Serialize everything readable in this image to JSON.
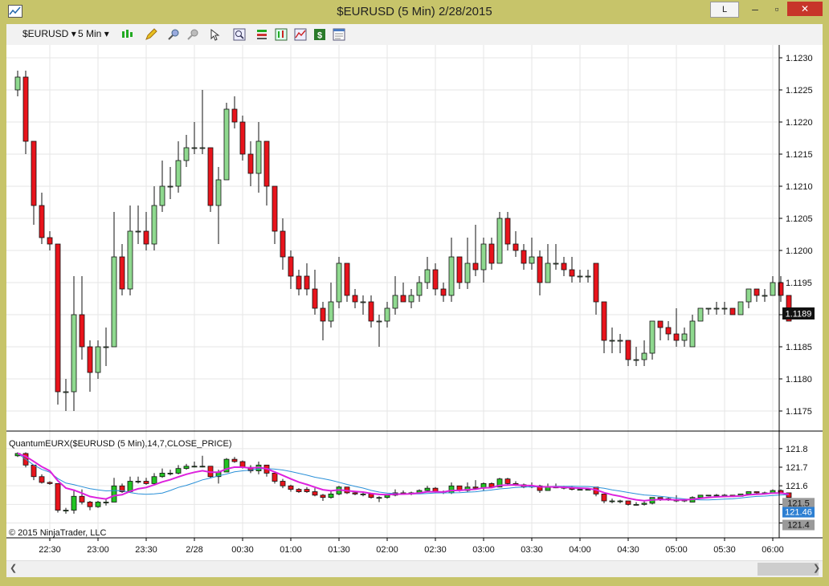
{
  "window": {
    "title": "$EURUSD (5 Min)  2/28/2015",
    "link_button": "L",
    "minimize_glyph": "‒",
    "maximize_glyph": "▫",
    "close_glyph": "✕"
  },
  "toolbar": {
    "instrument": "$EURUSD",
    "interval": "5 Min",
    "dropdown_glyph": "▾",
    "icons": [
      "bar-type-icon",
      "drawing-pencil-icon",
      "zoom-in-icon",
      "zoom-out-icon",
      "cursor-icon",
      "search-icon",
      "properties-icon",
      "strategies-icon",
      "indicators-icon",
      "dollar-icon",
      "data-box-icon"
    ]
  },
  "colors": {
    "up": "#8fd98f",
    "down": "#e8141c",
    "panel_up": "#22c422",
    "indicator_magenta": "#dd22dd",
    "indicator_blue": "#2a90d8",
    "last_price_bg": "#111111",
    "indicator_price_bg": "#2d7fd2"
  },
  "chart_data": [
    {
      "type": "candlestick",
      "panel": "price",
      "ylim": [
        1.1172,
        1.1232
      ],
      "y_ticks": [
        "1.1175",
        "1.1180",
        "1.1185",
        "1.1190",
        "1.1195",
        "1.1200",
        "1.1205",
        "1.1210",
        "1.1215",
        "1.1220",
        "1.1225",
        "1.1230"
      ],
      "x_ticks": [
        "22:30",
        "23:00",
        "23:30",
        "2/28",
        "00:30",
        "01:00",
        "01:30",
        "02:00",
        "02:30",
        "03:00",
        "03:30",
        "04:00",
        "04:30",
        "05:00",
        "05:30",
        "06:00"
      ],
      "last_price": "1.1189",
      "candles": [
        [
          1.1225,
          1.1227,
          1.1228,
          1.1224
        ],
        [
          1.1227,
          1.1217,
          1.1228,
          1.1215
        ],
        [
          1.1217,
          1.1207,
          1.1217,
          1.1204
        ],
        [
          1.1207,
          1.1202,
          1.1209,
          1.1201
        ],
        [
          1.1202,
          1.1201,
          1.1203,
          1.12
        ],
        [
          1.1201,
          1.1178,
          1.1201,
          1.1176
        ],
        [
          1.1178,
          1.1178,
          1.118,
          1.1175
        ],
        [
          1.1178,
          1.119,
          1.1196,
          1.1175
        ],
        [
          1.119,
          1.1185,
          1.1196,
          1.1183
        ],
        [
          1.1185,
          1.1181,
          1.1186,
          1.1178
        ],
        [
          1.1181,
          1.1185,
          1.1186,
          1.118
        ],
        [
          1.1185,
          1.1185,
          1.1188,
          1.1182
        ],
        [
          1.1185,
          1.1199,
          1.1206,
          1.1185
        ],
        [
          1.1199,
          1.1194,
          1.1201,
          1.1193
        ],
        [
          1.1194,
          1.1203,
          1.1207,
          1.1193
        ],
        [
          1.1203,
          1.1203,
          1.1207,
          1.1201
        ],
        [
          1.1203,
          1.1201,
          1.1206,
          1.12
        ],
        [
          1.1201,
          1.1207,
          1.121,
          1.12
        ],
        [
          1.1207,
          1.121,
          1.1214,
          1.1206
        ],
        [
          1.121,
          1.121,
          1.1213,
          1.1208
        ],
        [
          1.121,
          1.1214,
          1.1217,
          1.1209
        ],
        [
          1.1214,
          1.1216,
          1.1218,
          1.1213
        ],
        [
          1.1216,
          1.1216,
          1.122,
          1.1215
        ],
        [
          1.1216,
          1.1216,
          1.1225,
          1.1215
        ],
        [
          1.1216,
          1.1207,
          1.1216,
          1.1206
        ],
        [
          1.1207,
          1.1211,
          1.1213,
          1.1201
        ],
        [
          1.1211,
          1.1222,
          1.1223,
          1.1211
        ],
        [
          1.1222,
          1.122,
          1.1224,
          1.1219
        ],
        [
          1.122,
          1.1215,
          1.1221,
          1.1214
        ],
        [
          1.1215,
          1.1212,
          1.1217,
          1.121
        ],
        [
          1.1212,
          1.1217,
          1.122,
          1.1209
        ],
        [
          1.1217,
          1.121,
          1.1217,
          1.1207
        ],
        [
          1.121,
          1.1203,
          1.121,
          1.1201
        ],
        [
          1.1203,
          1.1199,
          1.1205,
          1.1197
        ],
        [
          1.1199,
          1.1196,
          1.12,
          1.1194
        ],
        [
          1.1196,
          1.1194,
          1.1197,
          1.1193
        ],
        [
          1.1196,
          1.1194,
          1.1198,
          1.1193
        ],
        [
          1.1194,
          1.1191,
          1.1197,
          1.119
        ],
        [
          1.1191,
          1.1189,
          1.1192,
          1.1186
        ],
        [
          1.1189,
          1.1192,
          1.1195,
          1.1188
        ],
        [
          1.1192,
          1.1198,
          1.1199,
          1.1191
        ],
        [
          1.1198,
          1.1193,
          1.1198,
          1.1192
        ],
        [
          1.1193,
          1.1192,
          1.1194,
          1.1191
        ],
        [
          1.1192,
          1.1192,
          1.1193,
          1.119
        ],
        [
          1.1192,
          1.1189,
          1.1193,
          1.1188
        ],
        [
          1.1189,
          1.1189,
          1.119,
          1.1185
        ],
        [
          1.1189,
          1.1191,
          1.1192,
          1.1188
        ],
        [
          1.1191,
          1.1193,
          1.1196,
          1.119
        ],
        [
          1.1193,
          1.1192,
          1.1195,
          1.1192
        ],
        [
          1.1192,
          1.1193,
          1.1194,
          1.1191
        ],
        [
          1.1193,
          1.1195,
          1.1196,
          1.1192
        ],
        [
          1.1195,
          1.1197,
          1.1199,
          1.1194
        ],
        [
          1.1197,
          1.1194,
          1.1198,
          1.1193
        ],
        [
          1.1194,
          1.1193,
          1.1195,
          1.1192
        ],
        [
          1.1193,
          1.1199,
          1.1202,
          1.1192
        ],
        [
          1.1199,
          1.1195,
          1.1199,
          1.1194
        ],
        [
          1.1195,
          1.1198,
          1.1202,
          1.1194
        ],
        [
          1.1198,
          1.1197,
          1.1204,
          1.1196
        ],
        [
          1.1197,
          1.1201,
          1.1202,
          1.1195
        ],
        [
          1.1201,
          1.1198,
          1.1202,
          1.1197
        ],
        [
          1.1198,
          1.1205,
          1.1206,
          1.1198
        ],
        [
          1.1205,
          1.1201,
          1.1206,
          1.12
        ],
        [
          1.1201,
          1.12,
          1.1203,
          1.1199
        ],
        [
          1.12,
          1.1198,
          1.1201,
          1.1197
        ],
        [
          1.1198,
          1.1199,
          1.1202,
          1.1197
        ],
        [
          1.1199,
          1.1195,
          1.12,
          1.1193
        ],
        [
          1.1195,
          1.1198,
          1.1201,
          1.1195
        ],
        [
          1.1198,
          1.1198,
          1.1201,
          1.1197
        ],
        [
          1.1198,
          1.1197,
          1.1199,
          1.1196
        ],
        [
          1.1197,
          1.1196,
          1.1199,
          1.1195
        ],
        [
          1.1196,
          1.1196,
          1.1197,
          1.1195
        ],
        [
          1.1196,
          1.1196,
          1.1197,
          1.1195
        ],
        [
          1.1198,
          1.1192,
          1.1198,
          1.119
        ],
        [
          1.1192,
          1.1186,
          1.1192,
          1.1184
        ],
        [
          1.1186,
          1.1186,
          1.1188,
          1.1184
        ],
        [
          1.1186,
          1.1186,
          1.1187,
          1.1184
        ],
        [
          1.1186,
          1.1183,
          1.1186,
          1.1182
        ],
        [
          1.1183,
          1.1183,
          1.1185,
          1.1182
        ],
        [
          1.1183,
          1.1184,
          1.1186,
          1.1182
        ],
        [
          1.1184,
          1.1189,
          1.1189,
          1.1183
        ],
        [
          1.1189,
          1.1188,
          1.1189,
          1.1186
        ],
        [
          1.1188,
          1.1187,
          1.1189,
          1.1186
        ],
        [
          1.1187,
          1.1186,
          1.1191,
          1.1185
        ],
        [
          1.1186,
          1.1187,
          1.1188,
          1.1185
        ],
        [
          1.1185,
          1.1189,
          1.119,
          1.1185
        ],
        [
          1.1189,
          1.1191,
          1.1191,
          1.1189
        ],
        [
          1.1191,
          1.1191,
          1.1191,
          1.119
        ],
        [
          1.1191,
          1.1191,
          1.1192,
          1.119
        ],
        [
          1.1191,
          1.1191,
          1.1192,
          1.119
        ],
        [
          1.1191,
          1.119,
          1.1191,
          1.119
        ],
        [
          1.119,
          1.1192,
          1.1192,
          1.119
        ],
        [
          1.1192,
          1.1194,
          1.1194,
          1.1191
        ],
        [
          1.1194,
          1.1193,
          1.1194,
          1.1192
        ],
        [
          1.1193,
          1.1193,
          1.1194,
          1.1192
        ],
        [
          1.1193,
          1.1195,
          1.1196,
          1.1193
        ],
        [
          1.1195,
          1.1193,
          1.1196,
          1.1192
        ],
        [
          1.1193,
          1.1189,
          1.1193,
          1.1189
        ]
      ]
    },
    {
      "type": "candlestick-with-lines",
      "panel": "indicator",
      "label": "QuantumEURX($EURUSD (5 Min),14,7,CLOSE_PRICE)",
      "ylim": [
        121.32,
        121.89
      ],
      "y_ticks": [
        "121.4",
        "121.5",
        "121.6",
        "121.7",
        "121.8"
      ],
      "price_labels": [
        "121.5",
        "121.46",
        "121.4"
      ],
      "scale_from_price": {
        "price_at": [
          1.1175,
          1.1228
        ],
        "ind_at": [
          121.45,
          121.78
        ]
      }
    }
  ],
  "copyright": "© 2015 NinjaTrader, LLC"
}
